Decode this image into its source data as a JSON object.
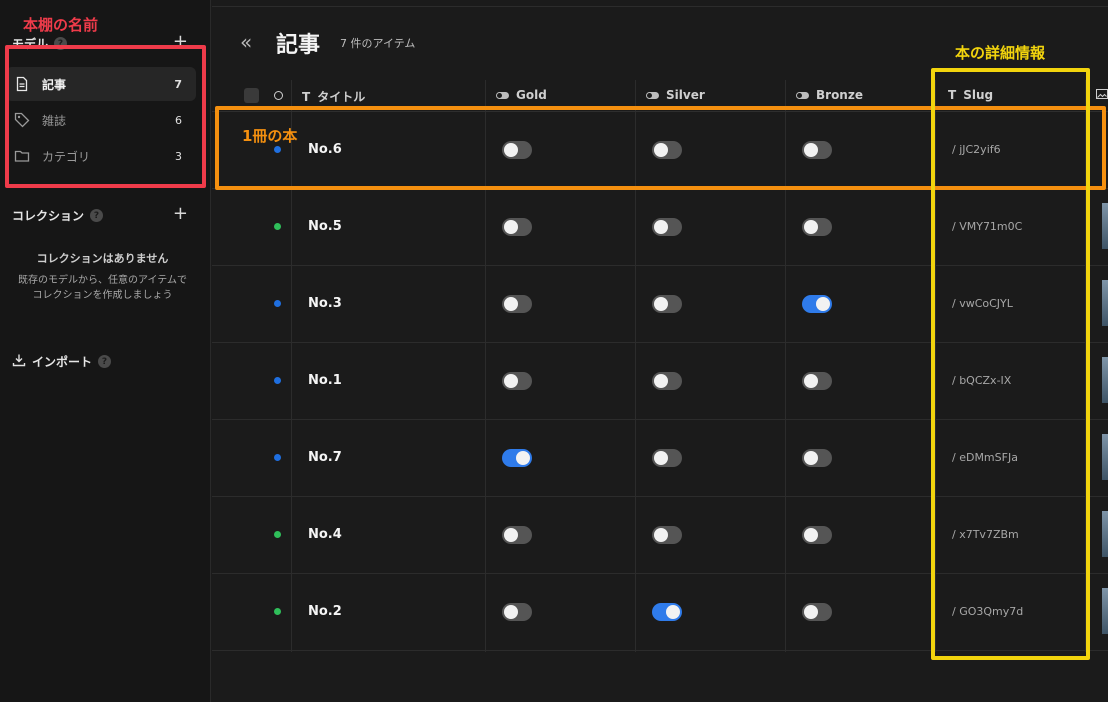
{
  "sidebar": {
    "model_header": "モデル",
    "help_glyph": "?",
    "add_glyph": "+",
    "items": [
      {
        "label": "記事",
        "count": "7",
        "icon": "document-icon"
      },
      {
        "label": "雑誌",
        "count": "6",
        "icon": "tag-icon"
      },
      {
        "label": "カテゴリ",
        "count": "3",
        "icon": "folder-icon"
      }
    ],
    "collection_header": "コレクション",
    "collection_empty_title": "コレクションはありません",
    "collection_empty_desc": "既存のモデルから、任意のアイテムで\nコレクションを作成しましょう",
    "import_label": "インポート"
  },
  "header": {
    "collapse_glyph": "«",
    "title": "記事",
    "item_count": "7 件のアイテム"
  },
  "table": {
    "columns": {
      "title": "タイトル",
      "gold": "Gold",
      "silver": "Silver",
      "bronze": "Bronze",
      "slug": "Slug"
    },
    "rows": [
      {
        "title": "No.6",
        "status": "blue",
        "gold": false,
        "silver": false,
        "bronze": false,
        "slug": "/ jJC2yif6"
      },
      {
        "title": "No.5",
        "status": "green",
        "gold": false,
        "silver": false,
        "bronze": false,
        "slug": "/ VMY71m0C"
      },
      {
        "title": "No.3",
        "status": "blue",
        "gold": false,
        "silver": false,
        "bronze": true,
        "slug": "/ vwCoCJYL"
      },
      {
        "title": "No.1",
        "status": "blue",
        "gold": false,
        "silver": false,
        "bronze": false,
        "slug": "/ bQCZx-IX"
      },
      {
        "title": "No.7",
        "status": "blue",
        "gold": true,
        "silver": false,
        "bronze": false,
        "slug": "/ eDMmSFJa"
      },
      {
        "title": "No.4",
        "status": "green",
        "gold": false,
        "silver": false,
        "bronze": false,
        "slug": "/ x7Tv7ZBm"
      },
      {
        "title": "No.2",
        "status": "green",
        "gold": false,
        "silver": true,
        "bronze": false,
        "slug": "/ GO3Qmy7d"
      }
    ]
  },
  "annotations": {
    "red": "本棚の名前",
    "orange": "1冊の本",
    "yellow": "本の詳細情報"
  },
  "colors": {
    "accent_blue": "#2f7bea",
    "status_blue": "#1f6fe0",
    "status_green": "#2fbf5a",
    "annotation_red": "#ef3b4a",
    "annotation_orange": "#f5900f",
    "annotation_yellow": "#f2d40d"
  }
}
